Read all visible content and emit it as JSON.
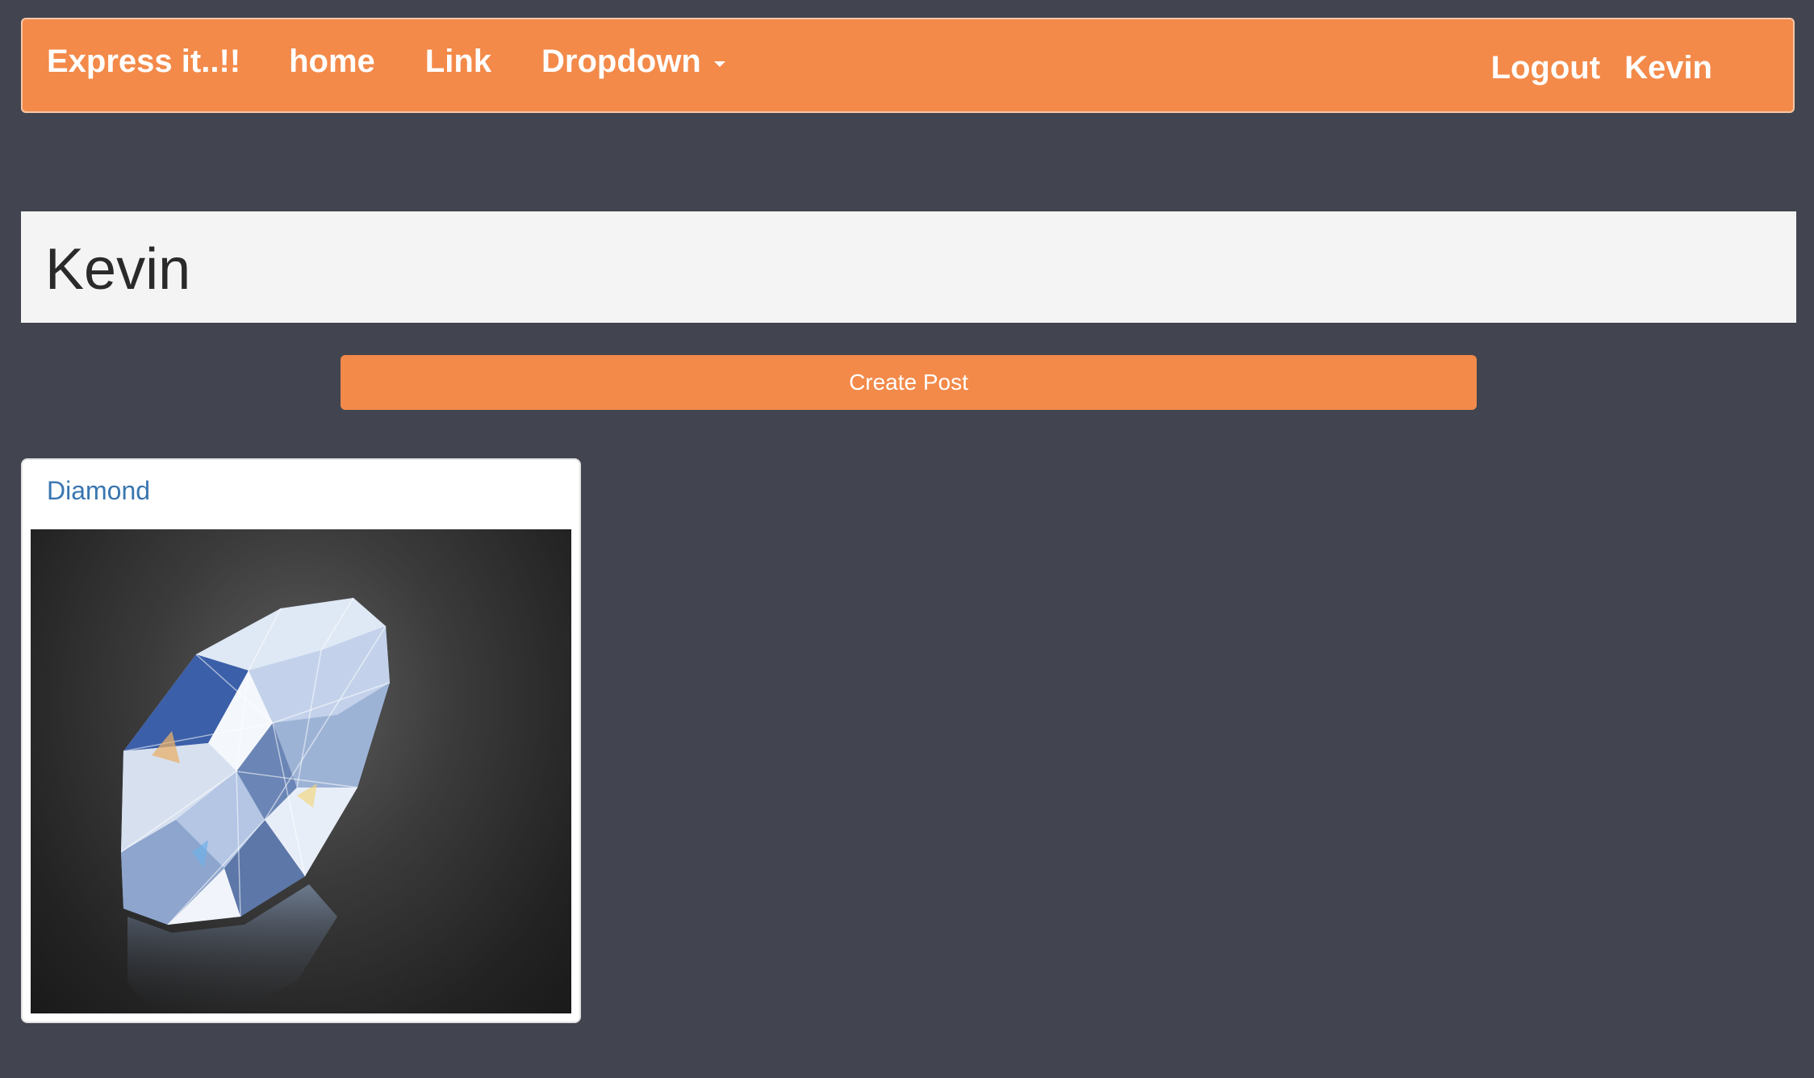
{
  "navbar": {
    "brand": "Express it..!!",
    "links": [
      "home",
      "Link"
    ],
    "dropdown_label": "Dropdown",
    "right_links": [
      "Logout",
      "Kevin"
    ],
    "accent_color": "#f38a4a"
  },
  "jumbotron": {
    "title": "Kevin"
  },
  "actions": {
    "create_post": "Create Post"
  },
  "posts": [
    {
      "title": "Diamond",
      "image": "diamond-image"
    }
  ],
  "colors": {
    "background": "#42454f",
    "jumbotron_bg": "#f4f4f4",
    "link_blue": "#3a76b0"
  }
}
